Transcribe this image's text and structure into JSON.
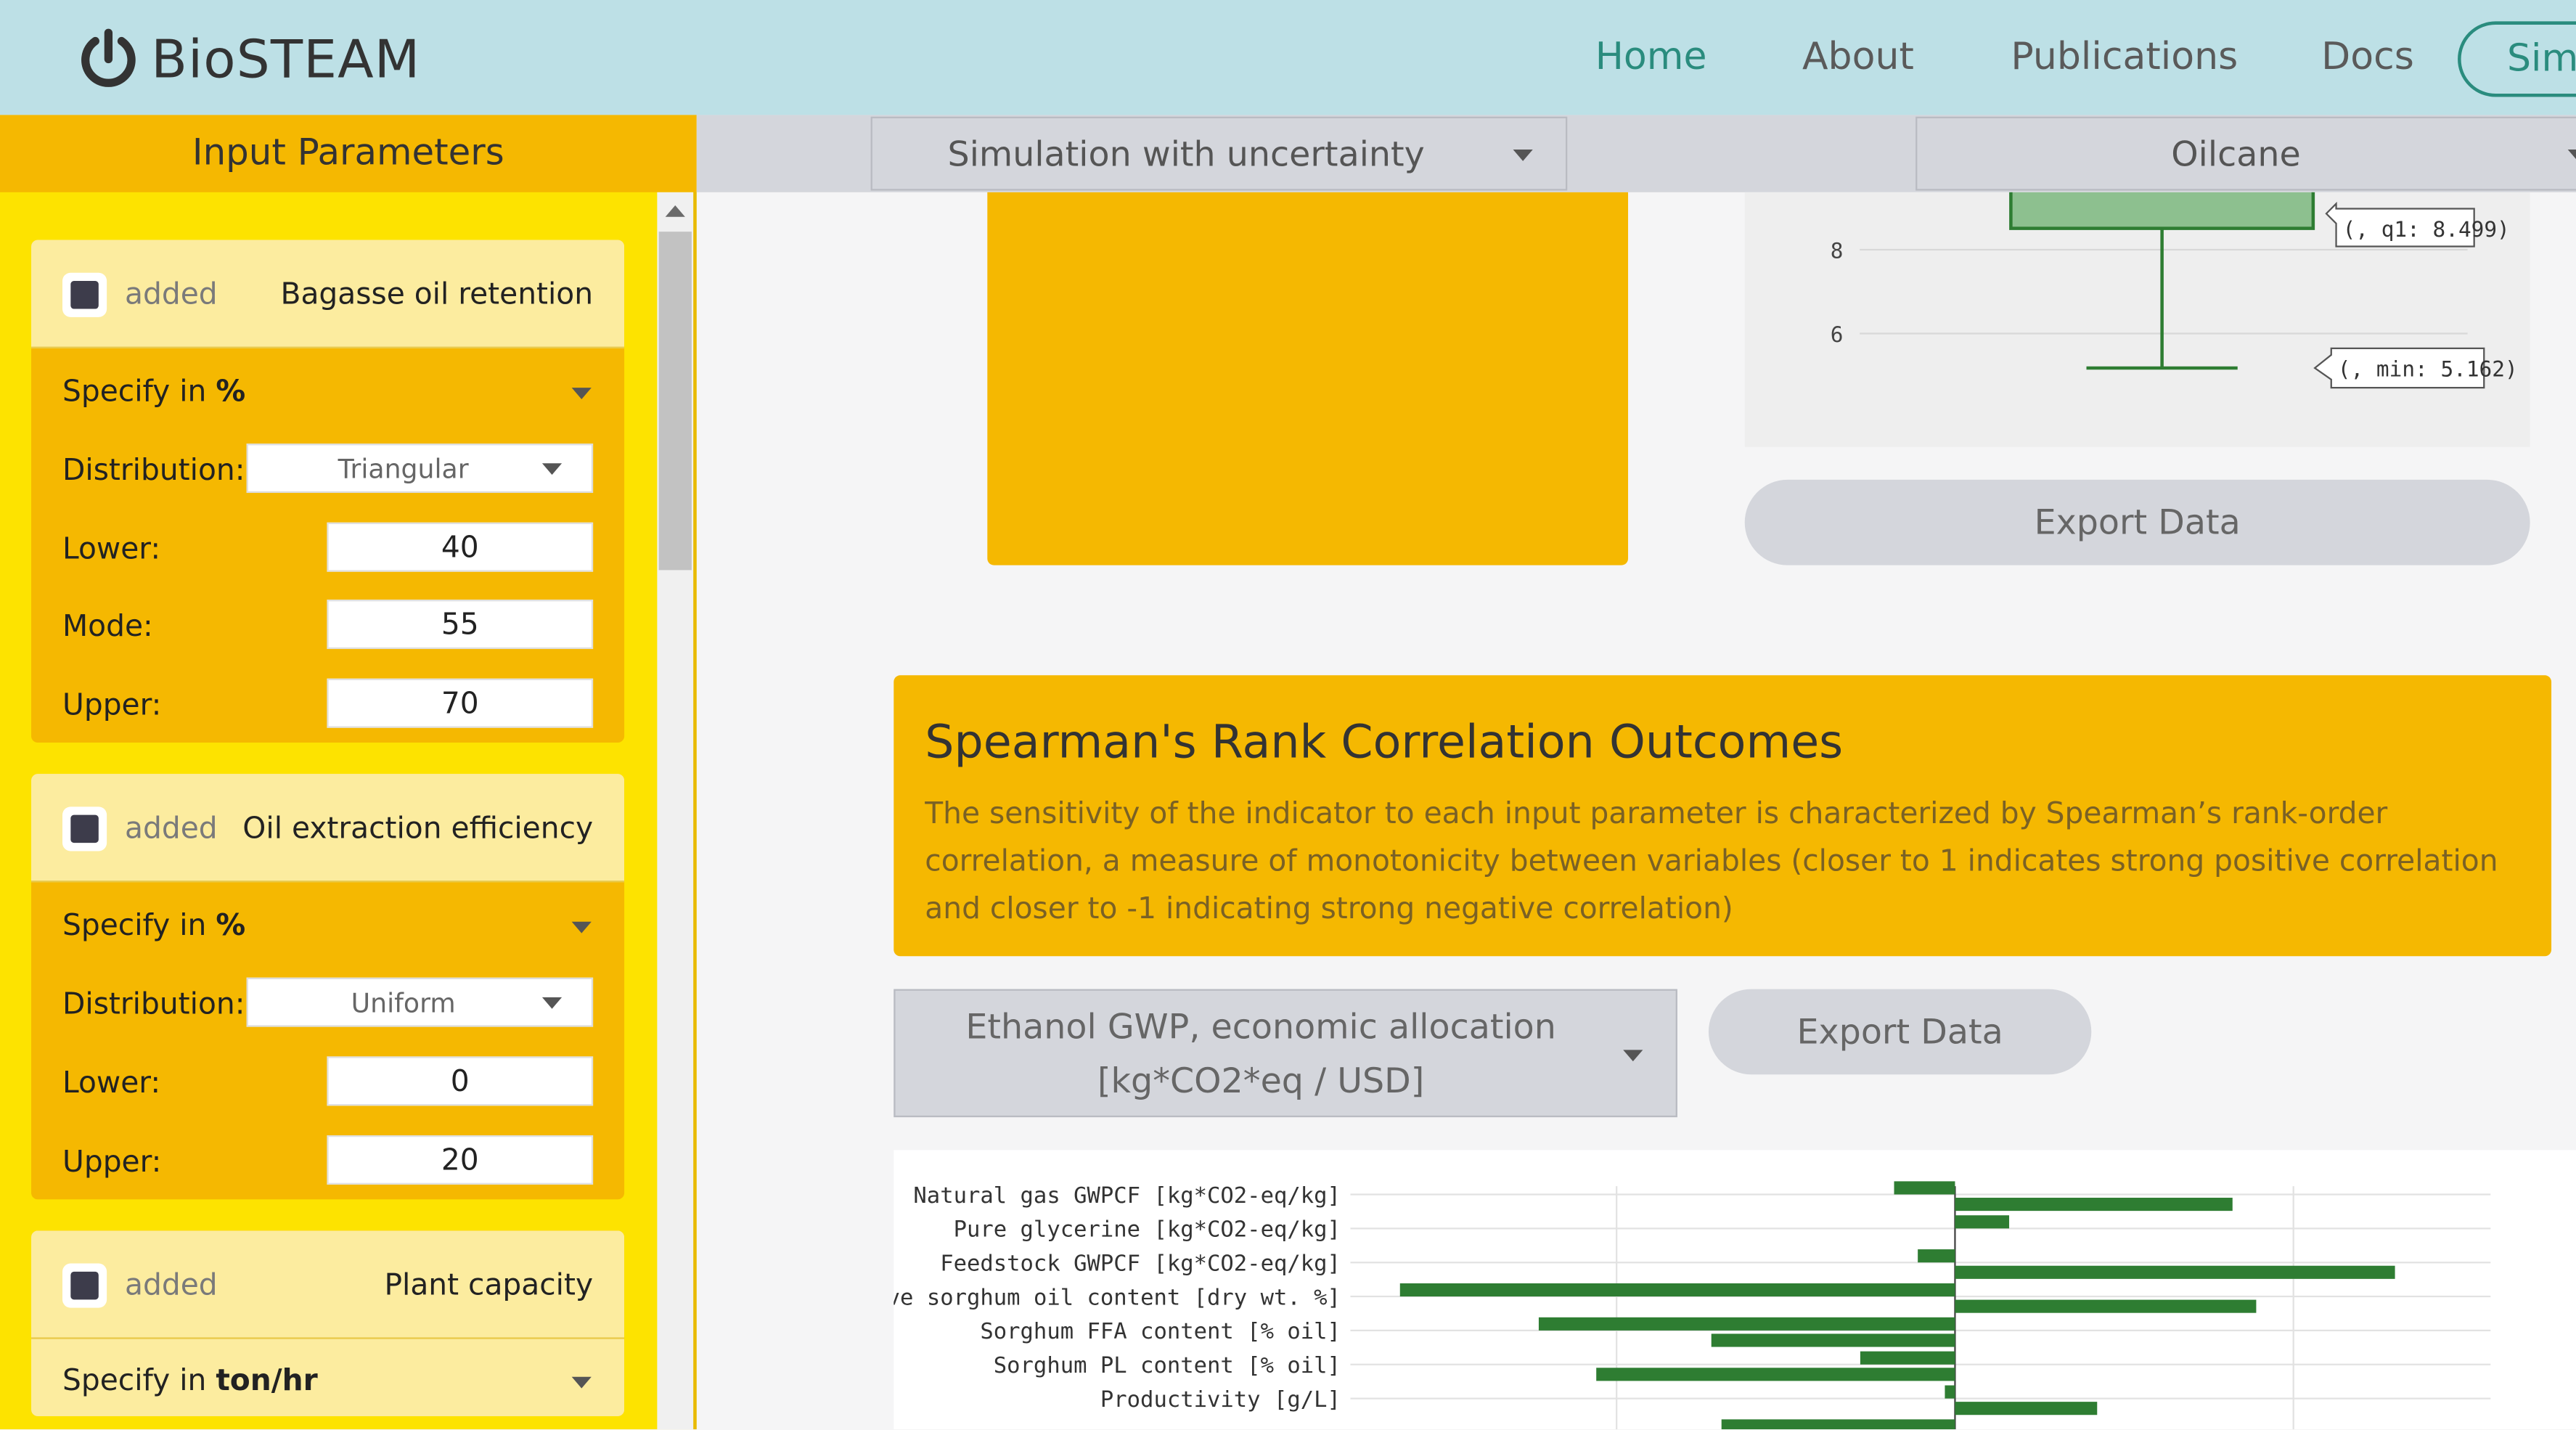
{
  "header": {
    "logo_text": "BioSTEAM",
    "nav": [
      "Home",
      "About",
      "Publications",
      "Docs"
    ],
    "cta_label": "Simu"
  },
  "sidebar": {
    "title": "Input Parameters",
    "cards": [
      {
        "checkbox_label": "added",
        "name": "Bagasse oil retention",
        "specify_prefix": "Specify in ",
        "specify_unit": "%",
        "distribution_label": "Distribution:",
        "distribution": "Triangular",
        "fields": [
          {
            "label": "Lower:",
            "value": "40"
          },
          {
            "label": "Mode:",
            "value": "55"
          },
          {
            "label": "Upper:",
            "value": "70"
          }
        ]
      },
      {
        "checkbox_label": "added",
        "name": "Oil extraction efficiency",
        "specify_prefix": "Specify in ",
        "specify_unit": "%",
        "distribution_label": "Distribution:",
        "distribution": "Uniform",
        "fields": [
          {
            "label": "Lower:",
            "value": "0"
          },
          {
            "label": "Upper:",
            "value": "20"
          }
        ]
      },
      {
        "checkbox_label": "added",
        "name": "Plant capacity",
        "specify_prefix": "Specify in ",
        "specify_unit": "ton/hr"
      }
    ]
  },
  "toolbar": {
    "mode": "Simulation with uncertainty",
    "feedstock": "Oilcane"
  },
  "box_plot": {
    "y_ticks": [
      "8",
      "6"
    ],
    "q1_label": "(, q1: 8.499)",
    "min_label": "(, min: 5.162)",
    "export_label": "Export Data"
  },
  "spearman": {
    "title": "Spearman's Rank Correlation Outcomes",
    "description": "The sensitivity of the indicator to each input parameter is characterized by Spearman’s rank-order correlation, a measure of monotonicity between variables (closer to 1 indicates strong positive correlation and closer to -1 indicating strong negative correlation)",
    "indicator_line1": "Ethanol GWP, economic allocation",
    "indicator_line2": "[kg*CO2*eq / USD]",
    "export_label": "Export Data"
  },
  "colors": {
    "bar": "#2e7d32",
    "accent": "#f5b801",
    "teal": "#2a8c7e"
  },
  "chart_data": {
    "type": "bar",
    "orientation": "horizontal",
    "categories": [
      "Natural gas GWPCF [kg*CO2-eq/kg]",
      "Pure glycerine [kg*CO2-eq/kg]",
      "Feedstock GWPCF [kg*CO2-eq/kg]",
      "ative sorghum oil content [dry wt. %]",
      "Sorghum FFA content [% oil]",
      "Sorghum PL content [% oil]",
      "Productivity [g/L]"
    ],
    "bars": [
      [
        -0.09,
        0.41
      ],
      [
        0.08
      ],
      [
        -0.055,
        0.65
      ],
      [
        -0.82,
        0.445
      ],
      [
        -0.615,
        -0.36
      ],
      [
        -0.14,
        -0.53
      ],
      [
        -0.015,
        0.21
      ],
      [
        -0.345
      ]
    ]
  }
}
